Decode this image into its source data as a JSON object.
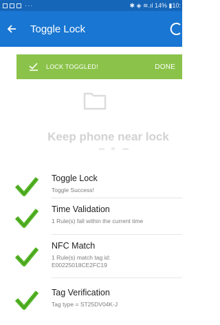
{
  "status_bar": {
    "right_text": "✱ ◈ ≋.ıl 14% ▮10:"
  },
  "app_bar": {
    "title": "Toggle Lock"
  },
  "snackbar": {
    "message": "LOCK TOGGLED!",
    "action": "DONE"
  },
  "hint": {
    "text": "Keep phone near lock"
  },
  "steps": [
    {
      "title": "Toggle Lock",
      "description": "Toggle Success!"
    },
    {
      "title": "Time Validation",
      "description": "1 Rule(s) fall within the current time"
    },
    {
      "title": "NFC Match",
      "description_line1": "1 Rule(s) match tag id:",
      "description_line2": "E00225018CE2FC19"
    },
    {
      "title": "Tag Verification",
      "description": "Tag type = ST25DV04K-J"
    }
  ],
  "colors": {
    "status_bar": "#1565b8",
    "app_bar": "#1976d2",
    "snackbar": "#8bc34a",
    "check": "#58b82a"
  }
}
